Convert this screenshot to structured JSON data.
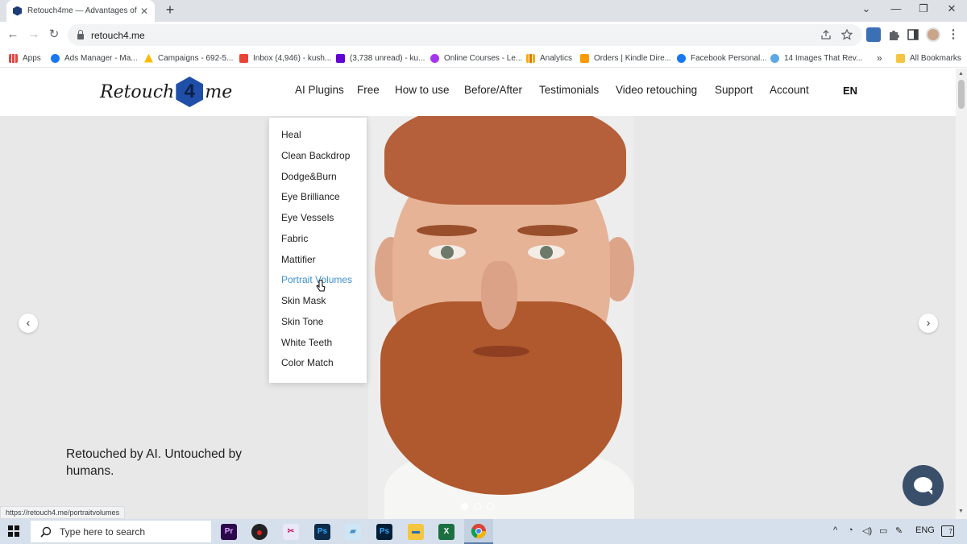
{
  "browser": {
    "tab_title": "Retouch4me — Advantages of A",
    "tab_close": "✕",
    "new_tab": "+",
    "window_controls": {
      "collapse": "⌄",
      "minimize": "—",
      "maximize": "❐",
      "close": "✕"
    },
    "url": "retouch4.me",
    "status_url": "https://retouch4.me/portraitvolumes",
    "nav": {
      "back": "←",
      "forward": "→",
      "reload": "↻"
    },
    "toolbar_icons": [
      "share-icon",
      "star-icon",
      "extension-icon",
      "puzzle-icon",
      "sidebar-icon",
      "avatar",
      "kebab-menu-icon"
    ]
  },
  "bookmarks": [
    {
      "label": "Apps",
      "icon": "apps-grid-icon",
      "color": "#e2463f"
    },
    {
      "label": "Ads Manager - Ma...",
      "icon": "meta-icon",
      "color": "#1877f2"
    },
    {
      "label": "Campaigns - 692-5...",
      "icon": "google-ads-icon",
      "color": "#fbbc04"
    },
    {
      "label": "Inbox (4,946) - kush...",
      "icon": "gmail-icon",
      "color": "#ea4335"
    },
    {
      "label": "(3,738 unread) - ku...",
      "icon": "yahoo-mail-icon",
      "color": "#6001d2"
    },
    {
      "label": "Online Courses - Le...",
      "icon": "udemy-icon",
      "color": "#a435f0"
    },
    {
      "label": "Analytics",
      "icon": "analytics-icon",
      "color": "#f9ab00"
    },
    {
      "label": "Orders | Kindle Dire...",
      "icon": "kdp-icon",
      "color": "#ff9900"
    },
    {
      "label": "Facebook Personal...",
      "icon": "facebook-icon",
      "color": "#1877f2"
    },
    {
      "label": "14 Images That Rev...",
      "icon": "site-icon",
      "color": "#5aa9e6"
    },
    {
      "label": "»",
      "icon": "",
      "color": ""
    },
    {
      "label": "All Bookmarks",
      "icon": "folder-icon",
      "color": "#f4c542"
    }
  ],
  "site": {
    "logo": {
      "left": "Retouch",
      "mark": "4",
      "right": "me"
    },
    "menu": [
      "AI Plugins",
      "Free",
      "How to use",
      "Before/After",
      "Testimonials",
      "Video retouching",
      "Support",
      "Account"
    ],
    "lang": "EN",
    "dropdown": {
      "items": [
        "Heal",
        "Clean Backdrop",
        "Dodge&Burn",
        "Eye Brilliance",
        "Eye Vessels",
        "Fabric",
        "Mattifier",
        "Portrait Volumes",
        "Skin Mask",
        "Skin Tone",
        "White Teeth",
        "Color Match"
      ],
      "hovered": "Portrait Volumes"
    },
    "hero": {
      "tagline": "Retouched by AI. Untouched by humans.",
      "prev": "‹",
      "next": "›",
      "slides": 3,
      "active_slide": 1
    },
    "accent_color": "#3a8fd6"
  },
  "taskbar": {
    "search_placeholder": "Type here to search",
    "apps": [
      {
        "name": "premiere-pro-icon",
        "label": "Pr",
        "bg": "#2a0a4a",
        "fg": "#d7a4ff"
      },
      {
        "name": "recorder-icon",
        "label": "●",
        "bg": "#222222",
        "fg": "#e02020"
      },
      {
        "name": "snip-tool-icon",
        "label": "✂",
        "bg": "#e8e8f8",
        "fg": "#c2185b"
      },
      {
        "name": "photoshop-icon",
        "label": "Ps",
        "bg": "#0d2b4a",
        "fg": "#31a8ff"
      },
      {
        "name": "notes-app-icon",
        "label": "▰",
        "bg": "#cfe6f5",
        "fg": "#4a90c4"
      },
      {
        "name": "photoshop-2-icon",
        "label": "Ps",
        "bg": "#001e36",
        "fg": "#31a8ff"
      },
      {
        "name": "file-explorer-icon",
        "label": "▬",
        "bg": "#f5c542",
        "fg": "#2a6fb0"
      },
      {
        "name": "excel-icon",
        "label": "X",
        "bg": "#1d6f42",
        "fg": "#ffffff"
      },
      {
        "name": "chrome-icon",
        "label": "",
        "bg": "",
        "fg": ""
      }
    ],
    "tray": {
      "chevron": "^",
      "lang": "ENG",
      "notifications": "7"
    }
  }
}
